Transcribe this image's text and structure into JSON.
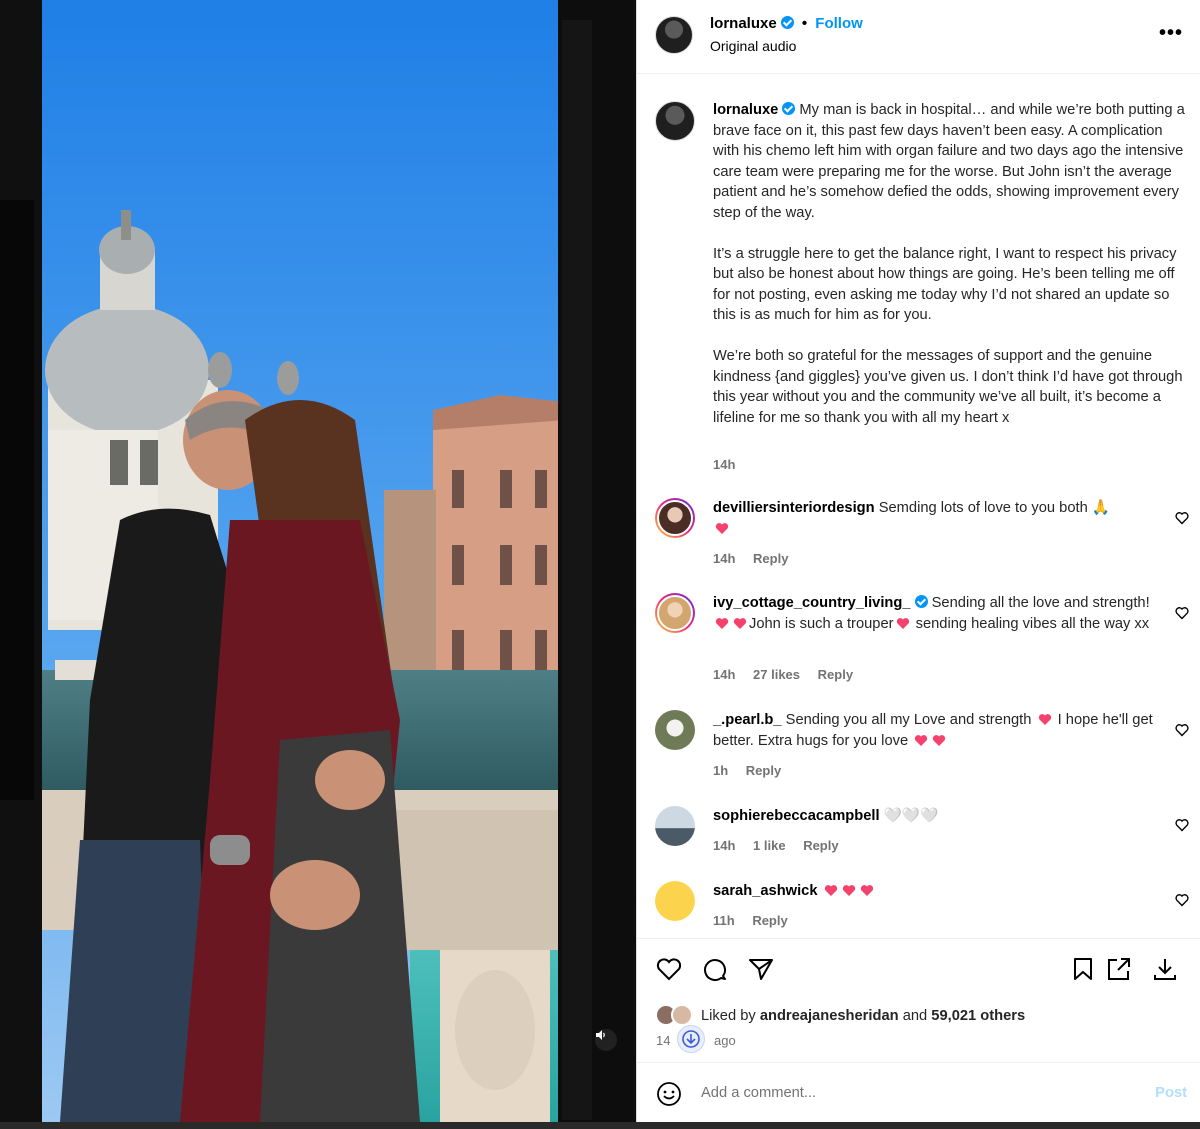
{
  "post": {
    "author": "lornaluxe",
    "follow_label": "Follow",
    "audio": "Original audio",
    "caption": [
      "My man is back in hospital… and while we’re both putting a brave face on it, this past few days haven’t been easy. A complication with his chemo left him with organ failure and two days ago the intensive care team were preparing me for the worse. But John isn’t the average patient and he’s somehow defied the odds, showing improvement every step of the way.",
      "It’s a struggle here to get the balance right, I want to respect his privacy but also be honest about how things are going. He’s been telling me off for not posting, even asking me today why I’d not shared an update so this is as much for him as for you.",
      "We’re both so grateful for the messages of support and the genuine kindness {and giggles} you’ve given us. I don’t think I’d have got through this year without you and the community we’ve all built, it’s become a lifeline for me so thank you with all my heart x"
    ],
    "time": "14h",
    "more_icon": "more-options-icon"
  },
  "comments": [
    {
      "user": "devilliersinteriordesign",
      "text": "Semding lots of love to you both",
      "emojis": "🙏",
      "time": "14h",
      "likes": "",
      "reply": "Reply"
    },
    {
      "user": "ivy_cottage_country_living_",
      "verified": true,
      "text_a": "Sending all the love and strength!",
      "text_b": "John is such a trouper",
      "text_c": "sending healing vibes all the way xx",
      "time": "14h",
      "likes": "27 likes",
      "reply": "Reply"
    },
    {
      "user": "_.pearl.b_",
      "text_a": "Sending you all my Love and strength",
      "text_b": "I hope he'll get better. Extra hugs for you love",
      "time": "1h",
      "likes": "",
      "reply": "Reply"
    },
    {
      "user": "sophierebeccacampbell",
      "text": "🤍🤍🤍",
      "time": "14h",
      "likes": "1 like",
      "reply": "Reply"
    },
    {
      "user": "sarah_ashwick",
      "text": "",
      "time": "11h",
      "likes": "",
      "reply": "Reply"
    }
  ],
  "actions": {
    "liked_prefix": "Liked by",
    "liked_by": "andreajanesheridan",
    "liked_and": "and",
    "liked_others": "59,021 others",
    "posted_num": "14",
    "posted_word": "ago"
  },
  "compose": {
    "placeholder": "Add a comment...",
    "post_label": "Post"
  },
  "colors": {
    "accent": "#0095f6",
    "heart": "#f5426c",
    "muted": "#737373"
  }
}
